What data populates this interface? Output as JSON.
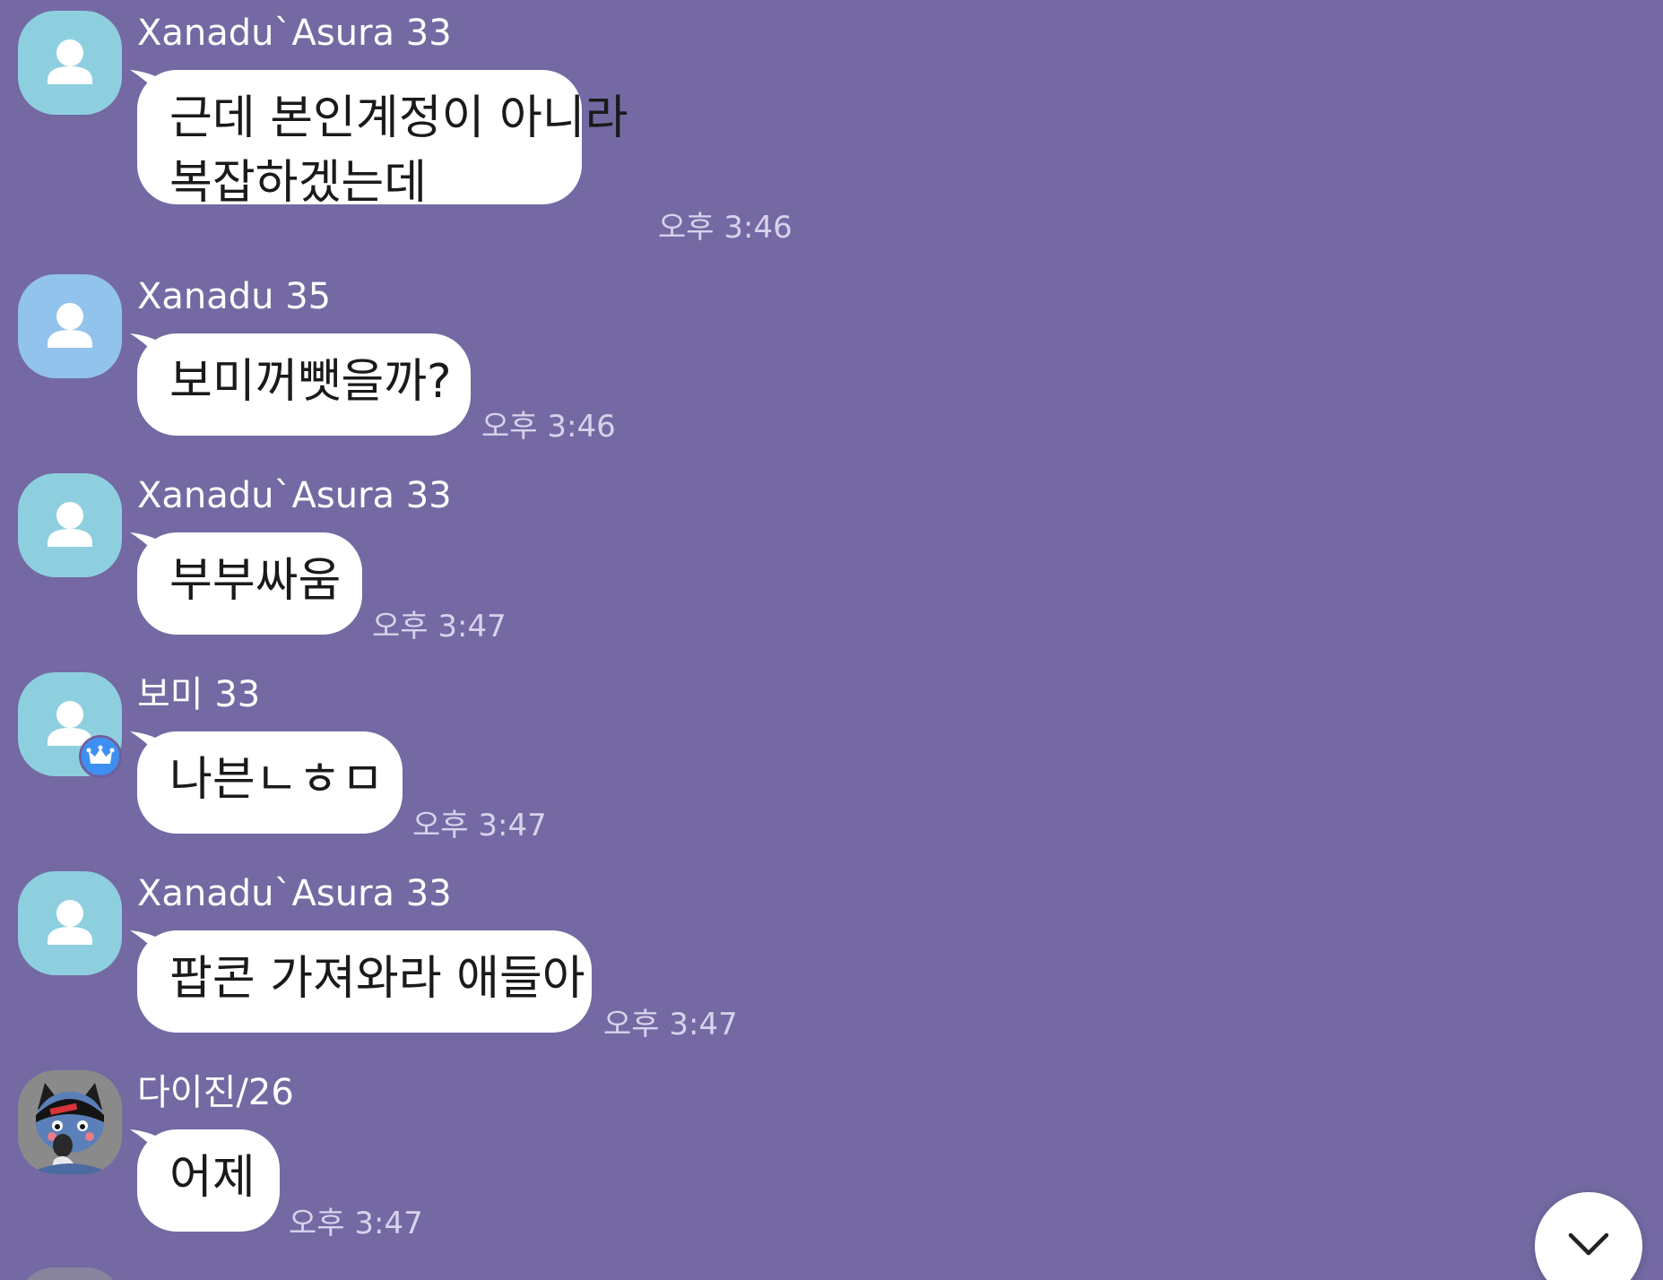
{
  "theme": {
    "background": "#7469a3",
    "bubble_bg": "#ffffff",
    "bubble_text": "#1a1a1a",
    "sender_text": "#ffffff",
    "time_text": "#d8d2ec",
    "avatar_teal": "#8ecfdf",
    "avatar_blue": "#92c3ec",
    "avatar_person": "#ffffff",
    "crown_badge": "#3d8ff2",
    "scroll_button_bg": "#ffffff",
    "scroll_button_icon": "#222222"
  },
  "messages": [
    {
      "sender": "Xanadu`Asura 33",
      "text_lines": [
        "근데 본인계정이 아니라",
        "복잡하겠는데"
      ],
      "time": "오후 3:46",
      "avatar_icon": "default-profile-icon",
      "avatar_color": "teal"
    },
    {
      "sender": "Xanadu 35",
      "text_lines": [
        "보미꺼뺏을까?"
      ],
      "time": "오후 3:46",
      "avatar_icon": "default-profile-icon",
      "avatar_color": "blue"
    },
    {
      "sender": "Xanadu`Asura 33",
      "text_lines": [
        "부부싸움"
      ],
      "time": "오후 3:47",
      "avatar_icon": "default-profile-icon",
      "avatar_color": "teal"
    },
    {
      "sender": "보미 33",
      "text_lines": [
        "나븐ㄴㅎㅁ"
      ],
      "time": "오후 3:47",
      "avatar_icon": "default-profile-icon",
      "avatar_color": "teal",
      "badge_icon": "crown-icon"
    },
    {
      "sender": "Xanadu`Asura 33",
      "text_lines": [
        "팝콘 가져와라 애들아"
      ],
      "time": "오후 3:47",
      "avatar_icon": "default-profile-icon",
      "avatar_color": "teal"
    },
    {
      "sender": "다이진/26",
      "text_lines": [
        "어제"
      ],
      "time": "오후 3:47",
      "avatar_icon": "cartoon-cat-avatar-icon",
      "avatar_color": "grey"
    }
  ],
  "scroll_button": {
    "icon": "chevron-down-icon"
  }
}
